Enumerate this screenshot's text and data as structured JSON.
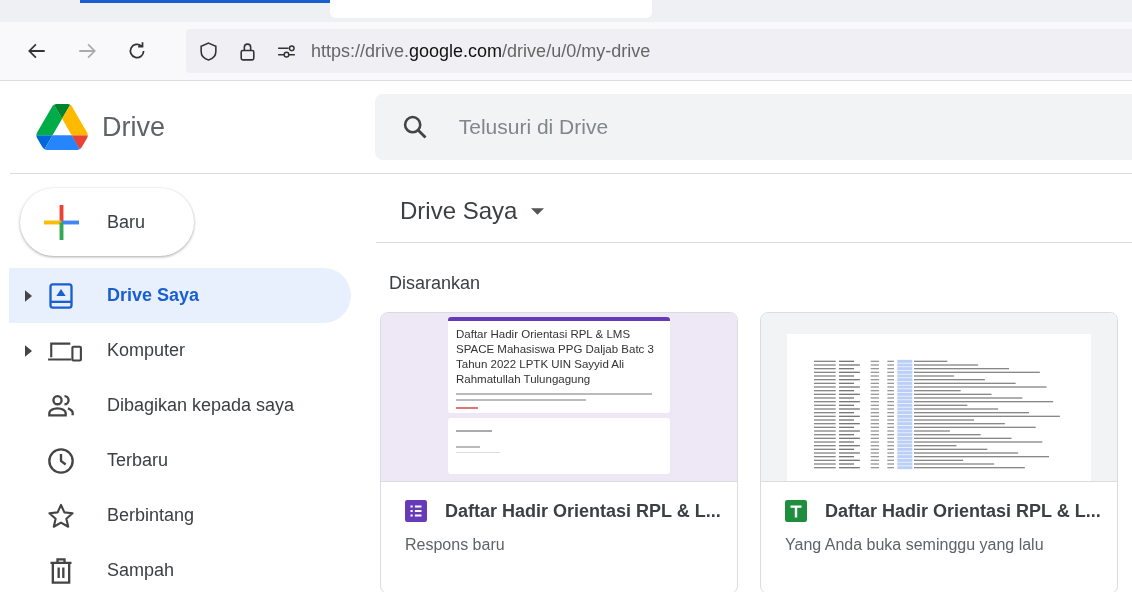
{
  "browser": {
    "url_prefix": "https://drive.",
    "url_domain": "google.com",
    "url_path": "/drive/u/0/my-drive"
  },
  "app": {
    "name": "Drive",
    "search_placeholder": "Telusuri di Drive"
  },
  "new_button": "Baru",
  "sidebar": {
    "items": [
      {
        "label": "Drive Saya",
        "kind": "drive",
        "expandable": true,
        "selected": true
      },
      {
        "label": "Komputer",
        "kind": "computer",
        "expandable": true,
        "selected": false
      },
      {
        "label": "Dibagikan kepada saya",
        "kind": "shared",
        "expandable": false,
        "selected": false
      },
      {
        "label": "Terbaru",
        "kind": "recent",
        "expandable": false,
        "selected": false
      },
      {
        "label": "Berbintang",
        "kind": "starred",
        "expandable": false,
        "selected": false
      },
      {
        "label": "Sampah",
        "kind": "trash",
        "expandable": false,
        "selected": false
      }
    ]
  },
  "breadcrumb": "Drive Saya",
  "section_title": "Disarankan",
  "files": [
    {
      "kind": "form",
      "name": "Daftar Hadir Orientasi RPL & L...",
      "subtitle": "Respons baru",
      "preview_title": "Daftar Hadir Orientasi RPL & LMS SPACE Mahasiswa PPG Daljab Batc 3 Tahun 2022 LPTK UIN Sayyid Ali Rahmatullah Tulungagung"
    },
    {
      "kind": "sheet",
      "name": "Daftar Hadir Orientasi RPL & L...",
      "subtitle": "Yang Anda buka seminggu yang lalu"
    }
  ]
}
